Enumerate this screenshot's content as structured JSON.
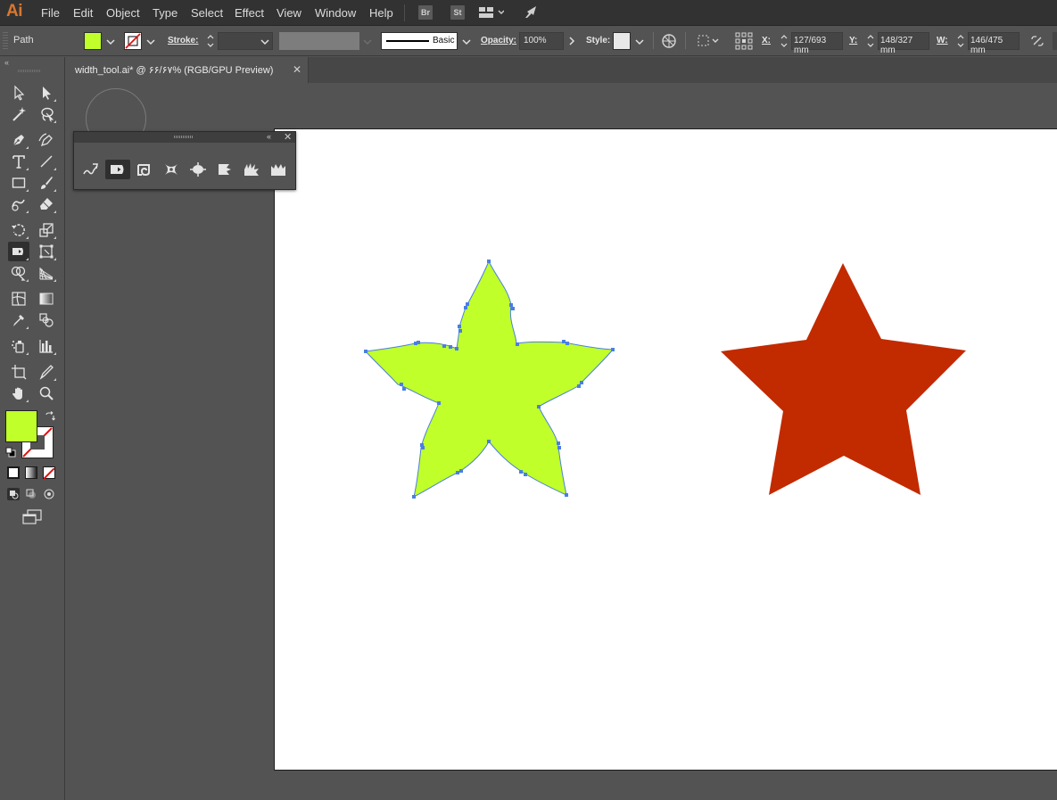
{
  "app": {
    "logo": "Ai"
  },
  "menu": [
    "File",
    "Edit",
    "Object",
    "Type",
    "Select",
    "Effect",
    "View",
    "Window",
    "Help"
  ],
  "menubar_icons": {
    "bridge": "Br",
    "stock": "St"
  },
  "control": {
    "selection_label": "Path",
    "fill_color": "#c0ff2a",
    "stroke_label": "Stroke:",
    "stroke_weight": "",
    "brush_label": "Basic",
    "opacity_label": "Opacity:",
    "opacity_value": "100%",
    "style_label": "Style:",
    "x_label": "X:",
    "x_value": "127/693 mm",
    "y_label": "Y:",
    "y_value": "148/327 mm",
    "w_label": "W:",
    "w_value": "146/475 mm"
  },
  "document": {
    "tab_title": "width_tool.ai* @ ۶۶/۶۷% (RGB/GPU Preview)",
    "close_glyph": "✕"
  },
  "tearoff": {
    "collapse_glyph": "«",
    "close_glyph": "✕"
  },
  "toolbar": {
    "collapse_glyph": "«"
  },
  "colors": {
    "ui_dark": "#323232",
    "ui_mid": "#535353",
    "accent_logo": "#d9772f",
    "selection_blue": "#4a7fe0",
    "star_left_fill": "#c0ff2a",
    "star_right_fill": "#c22a00"
  },
  "icons": {
    "toolbar": [
      "selection-tool-icon",
      "direct-selection-tool-icon",
      "magic-wand-tool-icon",
      "lasso-tool-icon",
      "pen-tool-icon",
      "curvature-tool-icon",
      "type-tool-icon",
      "line-segment-tool-icon",
      "rectangle-tool-icon",
      "paintbrush-tool-icon",
      "shaper-tool-icon",
      "eraser-tool-icon",
      "rotate-tool-icon",
      "scale-tool-icon",
      "width-tool-icon",
      "free-transform-tool-icon",
      "shape-builder-tool-icon",
      "perspective-grid-tool-icon",
      "mesh-tool-icon",
      "gradient-tool-icon",
      "eyedropper-tool-icon",
      "blend-tool-icon",
      "symbol-sprayer-tool-icon",
      "column-graph-tool-icon",
      "artboard-tool-icon",
      "slice-tool-icon",
      "hand-tool-icon",
      "zoom-tool-icon"
    ],
    "width_panel": [
      "warp-tool-icon",
      "width-tool-icon",
      "twirl-tool-icon",
      "pucker-tool-icon",
      "bloat-tool-icon",
      "scallop-tool-icon",
      "crystallize-tool-icon",
      "wrinkle-tool-icon"
    ]
  }
}
